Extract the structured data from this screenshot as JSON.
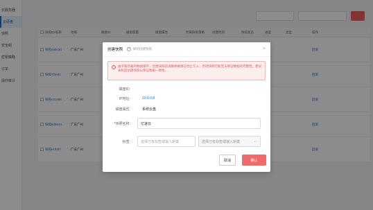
{
  "sidebar": {
    "items": [
      {
        "label": "云服务器",
        "active": false
      },
      {
        "label": "云硬盘",
        "active": true
      },
      {
        "label": "快照",
        "active": false
      },
      {
        "label": "安全组",
        "active": false
      },
      {
        "label": "密钥策略",
        "active": false
      },
      {
        "label": "订单",
        "active": false
      },
      {
        "label": "操作审计",
        "active": false
      }
    ]
  },
  "table": {
    "headers": [
      "快照ID/名称",
      "地域",
      "磁盘ID",
      "磁盘容量",
      "磁盘属性",
      "所属快照策略",
      "创建时间",
      "快照状态",
      "进度",
      "类型",
      "操作"
    ],
    "rows": [
      {
        "name": "快照4abc2d",
        "region": "广东广州",
        "ops": "回滚"
      },
      {
        "name": "快照7f3e91",
        "region": "广东广州",
        "ops": "回滚"
      },
      {
        "name": "快照c21a08",
        "region": "广东广州",
        "ops": "回滚"
      },
      {
        "name": "快照5d9e44",
        "region": "广东广州",
        "ops": "回滚"
      },
      {
        "name": "快照e1b2f7",
        "region": "广东广州",
        "ops": "回滚"
      }
    ]
  },
  "modal": {
    "title": "创建快照",
    "help_text": "如何创建快照",
    "close": "×",
    "warning": "由于服务器的数据缓存，创建快照前请确保磁盘已停止写入，否则快照可能无法保证数据的完整性。建议关机后创建快照以保证数据一致性。",
    "fields": {
      "disk_id_label": "磁盘ID:",
      "disk_id_value": "",
      "ip_label": "IP地址:",
      "ip_value": "10.0.0.8",
      "disk_attr_label": "磁盘属性:",
      "disk_attr_value": "系统云盘",
      "snapshot_name_label": "*快照名称:",
      "snapshot_name_value": "亿速云",
      "tag_label": "标签:",
      "tag_key_placeholder": "选择已有标签或输入新键",
      "tag_value_placeholder": "选择已有标签或输入新键"
    },
    "cancel_label": "取消",
    "ok_label": "确认"
  }
}
